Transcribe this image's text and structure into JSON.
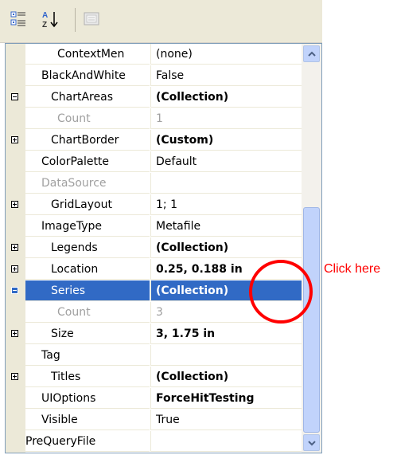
{
  "toolbar": {
    "categorized_icon": "categorized-icon",
    "alphabetical_icon": "alphabetical-icon",
    "property_pages_icon": "property-pages-icon"
  },
  "properties": [
    {
      "name": "ContextMen",
      "value": "(none)",
      "style": "indent2"
    },
    {
      "name": "BlackAndWhite",
      "value": "False",
      "style": "indent"
    },
    {
      "name": "ChartAreas",
      "value": "(Collection)",
      "style": "expanded",
      "bold": true
    },
    {
      "name": "Count",
      "value": "1",
      "style": "indent2",
      "dim": true
    },
    {
      "name": "ChartBorder",
      "value": "(Custom)",
      "style": "collapsed",
      "bold": true
    },
    {
      "name": "ColorPalette",
      "value": "Default",
      "style": "indent"
    },
    {
      "name": "DataSource",
      "value": "",
      "style": "indent",
      "dim": true
    },
    {
      "name": "GridLayout",
      "value": "1; 1",
      "style": "collapsed"
    },
    {
      "name": "ImageType",
      "value": "Metafile",
      "style": "indent"
    },
    {
      "name": "Legends",
      "value": "(Collection)",
      "style": "collapsed",
      "bold": true
    },
    {
      "name": "Location",
      "value": "0.25, 0.188 in",
      "style": "collapsed",
      "bold": true
    },
    {
      "name": "Series",
      "value": "(Collection)",
      "style": "expanded",
      "bold": true,
      "selected": true
    },
    {
      "name": "Count",
      "value": "3",
      "style": "indent2",
      "dim": true
    },
    {
      "name": "Size",
      "value": "3, 1.75 in",
      "style": "collapsed",
      "bold": true
    },
    {
      "name": "Tag",
      "value": "",
      "style": "indent"
    },
    {
      "name": "Titles",
      "value": "(Collection)",
      "style": "collapsed",
      "bold": true
    },
    {
      "name": "UIOptions",
      "value": "ForceHitTesting",
      "style": "indent",
      "bold": true
    },
    {
      "name": "Visible",
      "value": "True",
      "style": "indent"
    },
    {
      "name": "PreQueryFile",
      "value": "",
      "style": "none"
    }
  ],
  "ellipsis_label": "...",
  "callout": {
    "text": "Click here",
    "color": "#ff0000"
  },
  "colors": {
    "selection": "#316ac5",
    "margin": "#ece9d8"
  }
}
